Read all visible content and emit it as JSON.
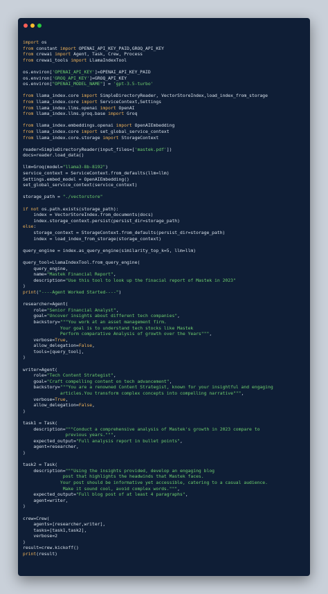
{
  "window": {
    "controls": [
      {
        "name": "close",
        "color": "#ff5f56"
      },
      {
        "name": "minimize",
        "color": "#ffbd2e"
      },
      {
        "name": "maximize",
        "color": "#27c93f"
      }
    ]
  },
  "code_lines": [
    [
      {
        "t": "k",
        "v": "import"
      },
      {
        "t": "p",
        "v": " os"
      }
    ],
    [
      {
        "t": "k",
        "v": "from"
      },
      {
        "t": "p",
        "v": " constant "
      },
      {
        "t": "k",
        "v": "import"
      },
      {
        "t": "p",
        "v": " OPENAI_API_KEY_PAID,GROQ_API_KEY"
      }
    ],
    [
      {
        "t": "k",
        "v": "from"
      },
      {
        "t": "p",
        "v": " crewai "
      },
      {
        "t": "k",
        "v": "import"
      },
      {
        "t": "p",
        "v": " Agent, Task, Crew, Process"
      }
    ],
    [
      {
        "t": "k",
        "v": "from"
      },
      {
        "t": "p",
        "v": " crewai_tools "
      },
      {
        "t": "k",
        "v": "import"
      },
      {
        "t": "p",
        "v": " LlamaIndexTool"
      }
    ],
    [],
    [
      {
        "t": "p",
        "v": "os.environ["
      },
      {
        "t": "s",
        "v": "'OPENAI_API_KEY'"
      },
      {
        "t": "p",
        "v": "]=OPENAI_API_KEY_PAID"
      }
    ],
    [
      {
        "t": "p",
        "v": "os.environ["
      },
      {
        "t": "s",
        "v": "'GROQ_API_KEY'"
      },
      {
        "t": "p",
        "v": "]=GROQ_API_KEY"
      }
    ],
    [
      {
        "t": "p",
        "v": "os.environ["
      },
      {
        "t": "s",
        "v": "\"OPENAI_MODEL_NAME\""
      },
      {
        "t": "p",
        "v": "] = "
      },
      {
        "t": "s",
        "v": "'gpt-3.5-turbo'"
      }
    ],
    [],
    [
      {
        "t": "k",
        "v": "from"
      },
      {
        "t": "p",
        "v": " llama_index.core "
      },
      {
        "t": "k",
        "v": "import"
      },
      {
        "t": "p",
        "v": " SimpleDirectoryReader, VectorStoreIndex,load_index_from_storage"
      }
    ],
    [
      {
        "t": "k",
        "v": "from"
      },
      {
        "t": "p",
        "v": " llama_index.core "
      },
      {
        "t": "k",
        "v": "import"
      },
      {
        "t": "p",
        "v": " ServiceContext,Settings"
      }
    ],
    [
      {
        "t": "k",
        "v": "from"
      },
      {
        "t": "p",
        "v": " llama_index.llms.openai "
      },
      {
        "t": "k",
        "v": "import"
      },
      {
        "t": "p",
        "v": " OpenAI"
      }
    ],
    [
      {
        "t": "k",
        "v": "from"
      },
      {
        "t": "p",
        "v": " llama_index.llms.groq.base "
      },
      {
        "t": "k",
        "v": "import"
      },
      {
        "t": "p",
        "v": " Groq"
      }
    ],
    [],
    [
      {
        "t": "k",
        "v": "from"
      },
      {
        "t": "p",
        "v": " llama_index.embeddings.openai "
      },
      {
        "t": "k",
        "v": "import"
      },
      {
        "t": "p",
        "v": " OpenAIEmbedding"
      }
    ],
    [
      {
        "t": "k",
        "v": "from"
      },
      {
        "t": "p",
        "v": " llama_index.core "
      },
      {
        "t": "k",
        "v": "import"
      },
      {
        "t": "p",
        "v": " set_global_service_context"
      }
    ],
    [
      {
        "t": "k",
        "v": "from"
      },
      {
        "t": "p",
        "v": " llama_index.core.storage "
      },
      {
        "t": "k",
        "v": "import"
      },
      {
        "t": "p",
        "v": " StorageContext"
      }
    ],
    [],
    [
      {
        "t": "p",
        "v": "reader=SimpleDirectoryReader(input_files=["
      },
      {
        "t": "s",
        "v": "'mastek.pdf'"
      },
      {
        "t": "p",
        "v": "])"
      }
    ],
    [
      {
        "t": "p",
        "v": "docs=reader.load_data()"
      }
    ],
    [],
    [
      {
        "t": "p",
        "v": "llm=Groq(model="
      },
      {
        "t": "s",
        "v": "\"llama3-8b-8192\""
      },
      {
        "t": "p",
        "v": ")"
      }
    ],
    [
      {
        "t": "p",
        "v": "service_context = ServiceContext.from_defaults(llm=llm)"
      }
    ],
    [
      {
        "t": "p",
        "v": "Settings.embed_model = OpenAIEmbedding()"
      }
    ],
    [
      {
        "t": "p",
        "v": "set_global_service_context(service_context)"
      }
    ],
    [],
    [
      {
        "t": "p",
        "v": "storage_path = "
      },
      {
        "t": "s",
        "v": "\"./vectorstore\""
      }
    ],
    [],
    [
      {
        "t": "k",
        "v": "if not"
      },
      {
        "t": "p",
        "v": " os.path.exists(storage_path):"
      }
    ],
    [
      {
        "t": "p",
        "v": "    index = VectorStoreIndex.from_documents(docs)"
      }
    ],
    [
      {
        "t": "p",
        "v": "    index.storage_context.persist(persist_dir=storage_path)"
      }
    ],
    [
      {
        "t": "k",
        "v": "else"
      },
      {
        "t": "p",
        "v": ":"
      }
    ],
    [
      {
        "t": "p",
        "v": "    storage_context = StorageContext.from_defaults(persist_dir=storage_path)"
      }
    ],
    [
      {
        "t": "p",
        "v": "    index = load_index_from_storage(storage_context)"
      }
    ],
    [],
    [
      {
        "t": "p",
        "v": "query_engine = index.as_query_engine(similarity_top_k=5, llm=llm)"
      }
    ],
    [],
    [
      {
        "t": "p",
        "v": "query_tool=LlamaIndexTool.from_query_engine("
      }
    ],
    [
      {
        "t": "p",
        "v": "    query_engine,"
      }
    ],
    [
      {
        "t": "p",
        "v": "    name="
      },
      {
        "t": "s",
        "v": "\"Mastek Financial Report\""
      },
      {
        "t": "p",
        "v": ","
      }
    ],
    [
      {
        "t": "p",
        "v": "    description="
      },
      {
        "t": "s",
        "v": "\"Use this tool to look up the finacial report of Mastek in 2023\""
      }
    ],
    [
      {
        "t": "p",
        "v": ")"
      }
    ],
    [
      {
        "t": "k",
        "v": "print"
      },
      {
        "t": "p",
        "v": "("
      },
      {
        "t": "s",
        "v": "\"----Agent Worked Started----\""
      },
      {
        "t": "p",
        "v": ")"
      }
    ],
    [],
    [
      {
        "t": "p",
        "v": "researcher=Agent("
      }
    ],
    [
      {
        "t": "p",
        "v": "    role="
      },
      {
        "t": "s",
        "v": "\"Senior Financial Analyst\""
      },
      {
        "t": "p",
        "v": ","
      }
    ],
    [
      {
        "t": "p",
        "v": "    goal="
      },
      {
        "t": "s",
        "v": "\"Uncover insights about different tech companies\""
      },
      {
        "t": "p",
        "v": ","
      }
    ],
    [
      {
        "t": "p",
        "v": "    backstory="
      },
      {
        "t": "s",
        "v": "\"\"\"You work at an asset management firm."
      }
    ],
    [
      {
        "t": "s",
        "v": "              Your goal is to understand tech stocks like Mastek"
      }
    ],
    [
      {
        "t": "s",
        "v": "              Perform comparative Analysis of growth over the Years\"\"\""
      },
      {
        "t": "p",
        "v": ","
      }
    ],
    [
      {
        "t": "p",
        "v": "    verbose="
      },
      {
        "t": "k",
        "v": "True"
      },
      {
        "t": "p",
        "v": ","
      }
    ],
    [
      {
        "t": "p",
        "v": "    allow_delegation="
      },
      {
        "t": "k",
        "v": "False"
      },
      {
        "t": "p",
        "v": ","
      }
    ],
    [
      {
        "t": "p",
        "v": "    tools=[query_tool],"
      }
    ],
    [
      {
        "t": "p",
        "v": ")"
      }
    ],
    [],
    [
      {
        "t": "p",
        "v": "writer=Agent("
      }
    ],
    [
      {
        "t": "p",
        "v": "    role="
      },
      {
        "t": "s",
        "v": "\"Tech Content Strategist\""
      },
      {
        "t": "p",
        "v": ","
      }
    ],
    [
      {
        "t": "p",
        "v": "    goal="
      },
      {
        "t": "s",
        "v": "\"Craft compelling content on tech advancement\""
      },
      {
        "t": "p",
        "v": ","
      }
    ],
    [
      {
        "t": "p",
        "v": "    backstory="
      },
      {
        "t": "s",
        "v": "\"\"\"You are a renowned Content Strategist, known for your insightful and engaging"
      }
    ],
    [
      {
        "t": "s",
        "v": "              articles.You transform complex concepts into compelling narrative\"\"\""
      },
      {
        "t": "p",
        "v": ","
      }
    ],
    [
      {
        "t": "p",
        "v": "    verbose="
      },
      {
        "t": "k",
        "v": "True"
      },
      {
        "t": "p",
        "v": ","
      }
    ],
    [
      {
        "t": "p",
        "v": "    allow_delegation="
      },
      {
        "t": "k",
        "v": "False"
      },
      {
        "t": "p",
        "v": ","
      }
    ],
    [
      {
        "t": "p",
        "v": ")"
      }
    ],
    [],
    [
      {
        "t": "p",
        "v": "task1 = Task("
      }
    ],
    [
      {
        "t": "p",
        "v": "    description="
      },
      {
        "t": "s",
        "v": "\"\"\"Conduct a comprehensive analysis of Mastek's growth in 2023 compare to"
      }
    ],
    [
      {
        "t": "s",
        "v": "                previous years.\"\"\""
      },
      {
        "t": "p",
        "v": ","
      }
    ],
    [
      {
        "t": "p",
        "v": "    expected_output="
      },
      {
        "t": "s",
        "v": "\"Full analysis report in bullet points\""
      },
      {
        "t": "p",
        "v": ","
      }
    ],
    [
      {
        "t": "p",
        "v": "    agent=researcher,"
      }
    ],
    [
      {
        "t": "p",
        "v": ")"
      }
    ],
    [],
    [
      {
        "t": "p",
        "v": "task2 = Task("
      }
    ],
    [
      {
        "t": "p",
        "v": "    description="
      },
      {
        "t": "s",
        "v": "\"\"\"Using the insights provided, develop an engaging blog"
      }
    ],
    [
      {
        "t": "s",
        "v": "               post that highlights the headwinds that Mastek faces."
      }
    ],
    [
      {
        "t": "s",
        "v": "              Your post should be informative yet accessible, catering to a casual audience."
      }
    ],
    [
      {
        "t": "s",
        "v": "               Make it sound cool, avoid complex words.\"\"\""
      },
      {
        "t": "p",
        "v": ","
      }
    ],
    [
      {
        "t": "p",
        "v": "    expected_output="
      },
      {
        "t": "s",
        "v": "\"Full blog post of at least 4 paragraphs\""
      },
      {
        "t": "p",
        "v": ","
      }
    ],
    [
      {
        "t": "p",
        "v": "    agent=writer,"
      }
    ],
    [
      {
        "t": "p",
        "v": ")"
      }
    ],
    [],
    [
      {
        "t": "p",
        "v": "crew=Crew("
      }
    ],
    [
      {
        "t": "p",
        "v": "    agents=[researcher,writer],"
      }
    ],
    [
      {
        "t": "p",
        "v": "    tasks=[task1,task2],"
      }
    ],
    [
      {
        "t": "p",
        "v": "    verbose=2"
      }
    ],
    [
      {
        "t": "p",
        "v": ")"
      }
    ],
    [
      {
        "t": "p",
        "v": "result=crew.kickoff()"
      }
    ],
    [
      {
        "t": "k",
        "v": "print"
      },
      {
        "t": "p",
        "v": "(result)"
      }
    ]
  ]
}
